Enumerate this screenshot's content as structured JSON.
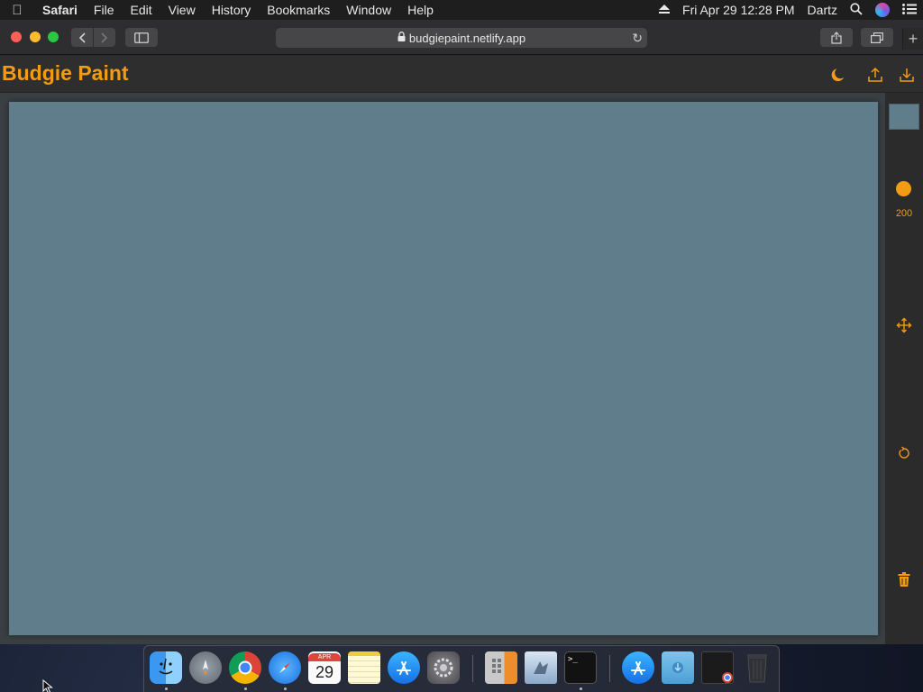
{
  "menubar": {
    "app_name": "Safari",
    "items": [
      "File",
      "Edit",
      "View",
      "History",
      "Bookmarks",
      "Window",
      "Help"
    ],
    "datetime": "Fri Apr 29  12:28 PM",
    "user": "Dartz"
  },
  "browser": {
    "url": "budgiepaint.netlify.app"
  },
  "app": {
    "title": "Budgie Paint",
    "accent_color": "#f39c12",
    "canvas_color": "#607d8b",
    "brush_size": "200"
  },
  "dock": {
    "calendar_month": "APR",
    "calendar_day": "29",
    "items": [
      "Finder",
      "Launchpad",
      "Google Chrome",
      "Safari",
      "Calendar",
      "Notes",
      "App Store",
      "System Preferences",
      "Calculator",
      "Preview",
      "Terminal",
      "App Store",
      "Downloads",
      "Chrome Window",
      "Trash"
    ]
  }
}
